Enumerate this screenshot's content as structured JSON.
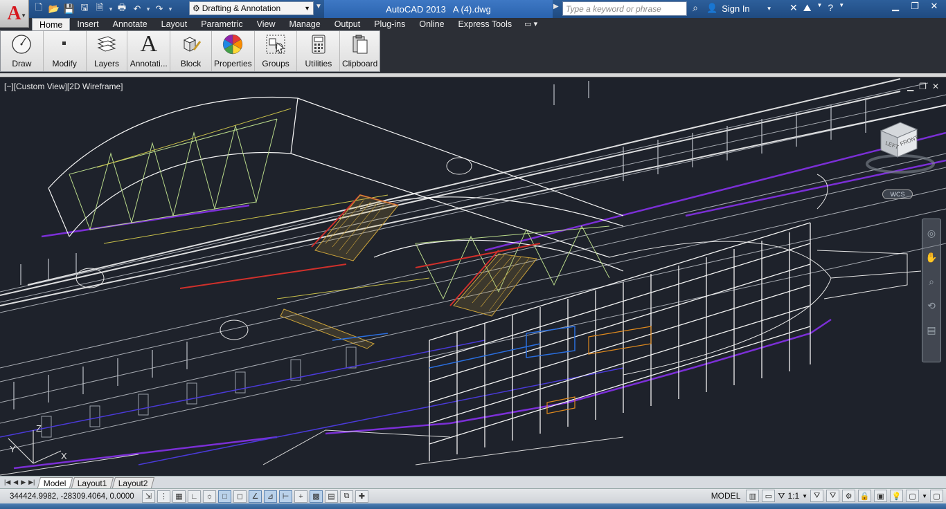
{
  "titlebar": {
    "workspace": "Drafting & Annotation",
    "app_name": "AutoCAD 2013",
    "file_name": "A (4).dwg",
    "search_placeholder": "Type a keyword or phrase",
    "sign_in": "Sign In"
  },
  "ribbon": {
    "tabs": [
      "Home",
      "Insert",
      "Annotate",
      "Layout",
      "Parametric",
      "View",
      "Manage",
      "Output",
      "Plug-ins",
      "Online",
      "Express Tools"
    ],
    "active_tab": "Home",
    "panels": [
      {
        "label": "Draw",
        "icon": "draw-circle-icon"
      },
      {
        "label": "Modify",
        "icon": "modify-icon"
      },
      {
        "label": "Layers",
        "icon": "layers-icon"
      },
      {
        "label": "Annotati...",
        "icon": "text-annotation-icon"
      },
      {
        "label": "Block",
        "icon": "block-icon"
      },
      {
        "label": "Properties",
        "icon": "color-wheel-icon"
      },
      {
        "label": "Groups",
        "icon": "groups-icon"
      },
      {
        "label": "Utilities",
        "icon": "calculator-icon"
      },
      {
        "label": "Clipboard",
        "icon": "clipboard-icon"
      }
    ]
  },
  "viewport": {
    "view_label": "[−][Custom View][2D Wireframe]",
    "viewcube": {
      "left": "LEFT",
      "front": "FRONT",
      "wcs": "WCS"
    },
    "ucs": {
      "x": "X",
      "y": "Y",
      "z": "Z"
    }
  },
  "layout_tabs": [
    "Model",
    "Layout1",
    "Layout2"
  ],
  "statusbar": {
    "coordinates": "344424.9982, -28309.4064, 0.0000",
    "space": "MODEL",
    "annotation_scale": "1:1"
  },
  "colors": {
    "title_bg": "#2d5f9b",
    "viewport_bg": "#1e222b",
    "ribbon_bg": "#2c2f36",
    "autocad_red": "#d6171e"
  }
}
